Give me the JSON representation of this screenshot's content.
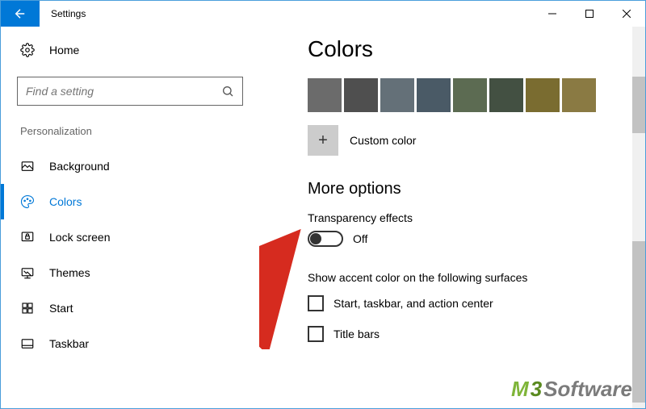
{
  "window": {
    "title": "Settings"
  },
  "sidebar": {
    "home_label": "Home",
    "search_placeholder": "Find a setting",
    "section_title": "Personalization",
    "items": [
      {
        "label": "Background"
      },
      {
        "label": "Colors"
      },
      {
        "label": "Lock screen"
      },
      {
        "label": "Themes"
      },
      {
        "label": "Start"
      },
      {
        "label": "Taskbar"
      }
    ]
  },
  "main": {
    "heading": "Colors",
    "swatches": [
      "#6b6b6b",
      "#4f4f4f",
      "#647078",
      "#4a5a66",
      "#5c6b52",
      "#435042",
      "#7a6c30",
      "#8a7a43"
    ],
    "custom_color_label": "Custom color",
    "more_options_heading": "More options",
    "transparency_label": "Transparency effects",
    "transparency_state": "Off",
    "surfaces_label": "Show accent color on the following surfaces",
    "checkbox_start": "Start, taskbar, and action center",
    "checkbox_titlebar": "Title bars"
  },
  "watermark": {
    "brand_prefix": "M3",
    "brand_suffix": " Software"
  }
}
